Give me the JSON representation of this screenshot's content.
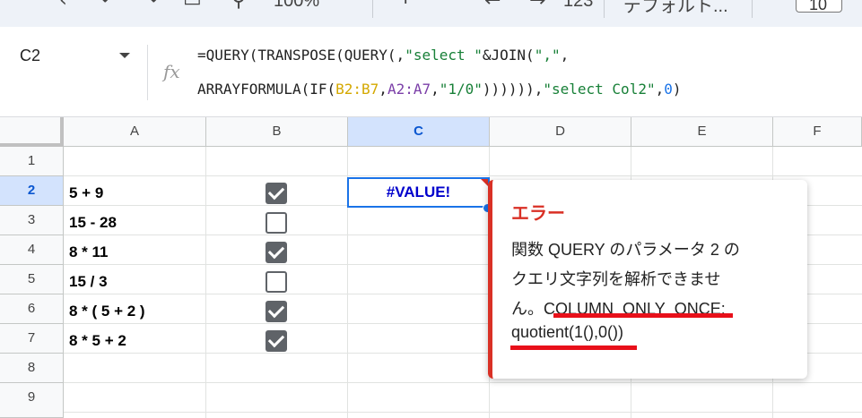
{
  "toolbar": {
    "zoom": "100%",
    "font_label": "デフォルト...",
    "font_size": "10"
  },
  "formula_bar": {
    "cell_ref": "C2",
    "fx_label": "fx",
    "formula": {
      "p1": "=QUERY(TRANSPOSE(QUERY(,",
      "p2": "\"select \"",
      "p3": "&JOIN(",
      "p4": "\",\"",
      "p5": ",",
      "p6": "ARRAYFORMULA(IF(",
      "p7": "B2:B7",
      "p8": ",",
      "p9": "A2:A7",
      "p10": ",",
      "p11": "\"1/0\"",
      "p12": ")))))),",
      "p13": "\"select Col2\"",
      "p14": ",",
      "p15": "0",
      "p16": ")"
    }
  },
  "grid": {
    "columns": [
      "A",
      "B",
      "C",
      "D",
      "E",
      "F"
    ],
    "rows": [
      "1",
      "2",
      "3",
      "4",
      "5",
      "6",
      "7",
      "8",
      "9"
    ],
    "col_a": [
      "5 + 9",
      "15 - 28",
      "8 * 11",
      "15 / 3",
      "8 * ( 5 + 2 )",
      "8 * 5 + 2"
    ],
    "col_b_checked": [
      true,
      false,
      true,
      false,
      true,
      true
    ],
    "c2_value": "#VALUE!"
  },
  "error_popup": {
    "title": "エラー",
    "line1": "関数 QUERY のパラメータ 2 の",
    "line2": "クエリ文字列を解析できませ",
    "line3_a": "ん。",
    "line3_b": "COLUMN_ONLY_ONCE:",
    "line4": "quotient(1(),0())"
  },
  "colors": {
    "selection": "#1a73e8",
    "error": "#d93025",
    "annotation": "#e8101a"
  }
}
